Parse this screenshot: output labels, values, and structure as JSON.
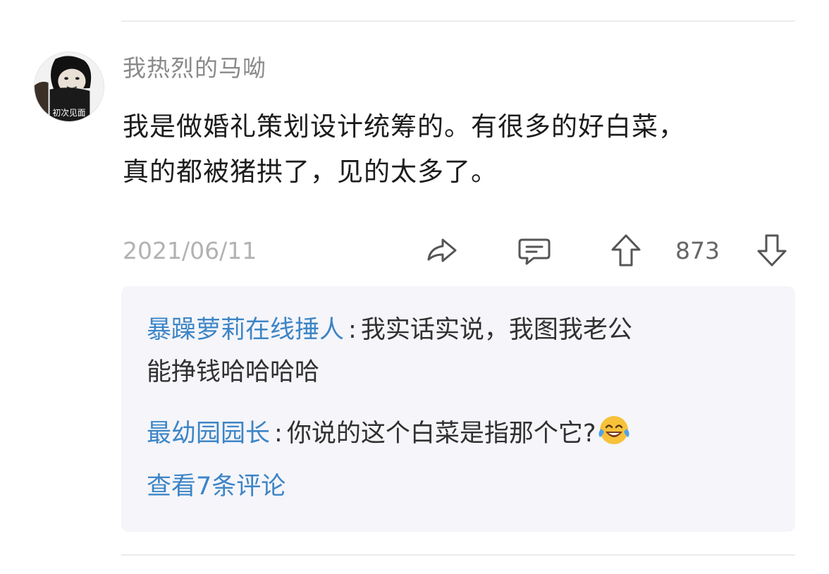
{
  "post": {
    "username": "我热烈的马呦",
    "content_lines": [
      "我是做婚礼策划设计统筹的。有很多的好白菜，",
      "真的都被猪拱了，见的太多了。"
    ],
    "date": "2021/06/11",
    "vote_count": "873",
    "avatar_caption": "初次见面"
  },
  "actions": {
    "share_icon": "share-icon",
    "comment_icon": "comment-icon",
    "upvote_icon": "upvote-icon",
    "downvote_icon": "downvote-icon"
  },
  "replies": [
    {
      "author": "暴躁萝莉在线捶人",
      "separator": ":",
      "text_line1": "我实话实说，我图我老公",
      "text_line2": "能挣钱哈哈哈哈"
    },
    {
      "author": "最幼园园长",
      "separator": ":",
      "text": "你说的这个白菜是指那个它?",
      "emoji": "tears-of-joy-emoji"
    }
  ],
  "more_replies_label": "查看7条评论",
  "colors": {
    "link_blue": "#3d85c6",
    "username_gray": "#8a8a8a",
    "reply_panel_bg": "#f5f5fa"
  }
}
